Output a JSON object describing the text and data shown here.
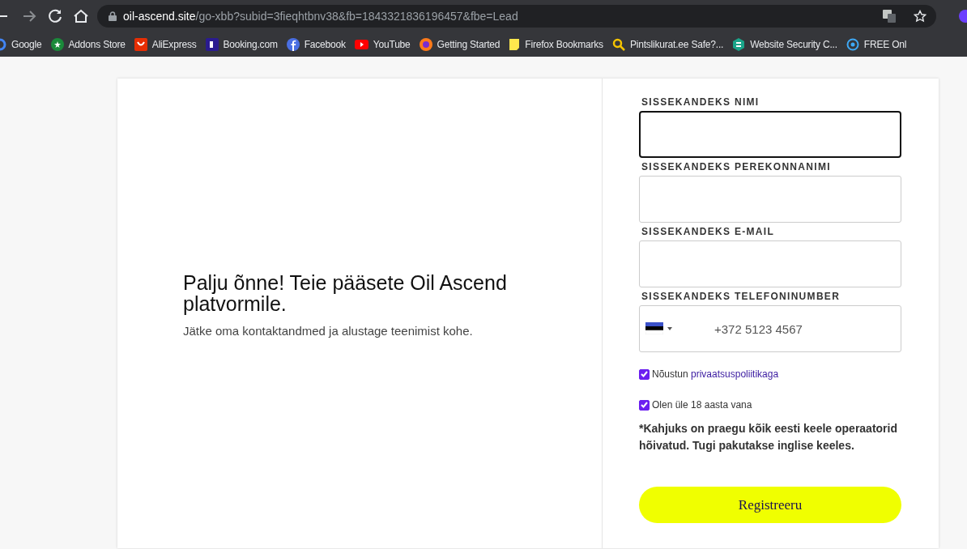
{
  "address_bar": {
    "host": "oil-ascend.site",
    "path": "/go-xbb?subid=3fieqhtbnv38&fb=1843321836196457&fbe=Lead"
  },
  "bookmarks": [
    {
      "label": "Google"
    },
    {
      "label": "Addons Store"
    },
    {
      "label": "AliExpress"
    },
    {
      "label": "Booking.com"
    },
    {
      "label": "Facebook"
    },
    {
      "label": "YouTube"
    },
    {
      "label": "Getting Started"
    },
    {
      "label": "Firefox Bookmarks"
    },
    {
      "label": "Pintslikurat.ee Safe?..."
    },
    {
      "label": "Website Security C..."
    },
    {
      "label": "FREE Onl"
    }
  ],
  "intro": {
    "title": "Palju õnne! Teie pääsete Oil Ascend platvormile.",
    "subtitle": "Jätke oma kontaktandmed ja alustage teenimist kohe."
  },
  "form": {
    "fields": [
      {
        "label": "SISSEKANDEKS NIMI",
        "kind": "text",
        "focused": true
      },
      {
        "label": "SISSEKANDEKS PEREKONNANIMI",
        "kind": "text",
        "focused": false
      },
      {
        "label": "SISSEKANDEKS E-MAIL",
        "kind": "text",
        "focused": false
      },
      {
        "label": "SISSEKANDEKS TELEFONINUMBER",
        "kind": "phone",
        "focused": false,
        "placeholder": "+372 5123 4567"
      }
    ],
    "checkboxes": [
      {
        "text": "Nõustun",
        "link": "privaatsuspoliitikaga",
        "checked": true
      },
      {
        "text": "Olen üle 18 aasta vana",
        "checked": true
      }
    ],
    "notice": "*Kahjuks on praegu kõik eesti keele operaatorid hõivatud. Tugi pakutakse inglise keeles.",
    "submit": "Registreeru"
  }
}
